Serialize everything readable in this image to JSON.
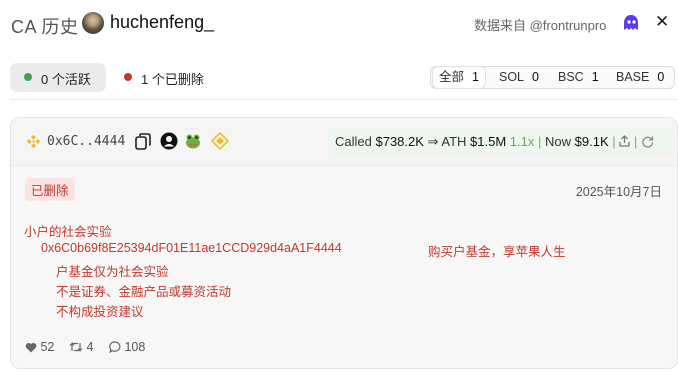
{
  "header": {
    "title": "CA 历史",
    "username": "huchenfeng_",
    "source_label": "数据来自 @frontrunpro",
    "close_glyph": "✕"
  },
  "tabs": [
    {
      "label": "0 个活跃",
      "status_color": "#3fa34d",
      "selected": true
    },
    {
      "label": "1 个已删除",
      "status_color": "#c0392b",
      "selected": false
    }
  ],
  "chains": [
    {
      "label": "全部",
      "count": "1",
      "selected": true
    },
    {
      "label": "SOL",
      "count": "0",
      "selected": false
    },
    {
      "label": "BSC",
      "count": "1",
      "selected": false
    },
    {
      "label": "BASE",
      "count": "0",
      "selected": false
    }
  ],
  "card": {
    "chain_icon": "bnb-icon",
    "address_short": "0x6C..4444",
    "price": {
      "called_label": "Called",
      "called_value": "$738.2K",
      "arrow": "⇒",
      "ath_label": "ATH",
      "ath_value": "$1.5M",
      "multiplier": "1.1x",
      "separator": "|",
      "now_label": "Now",
      "now_value": "$9.1K"
    },
    "status_badge": "已删除",
    "date": "2025年10月7日",
    "tweet_lines": [
      "小户的社会实验",
      "0x6C0b69f8E25394dF01E11ae1CCD929d4aA1F4444",
      "购买户基金，享苹果人生",
      "户基金仅为社会实验",
      "不是证券、金融产品或募资活动",
      "不构成投资建议"
    ],
    "stats": {
      "likes": "52",
      "retweets": "4",
      "replies": "108"
    },
    "accent_colors": {
      "deleted": "#c0392b",
      "positive": "#6aa84f",
      "bnb": "#f3ba2f"
    }
  }
}
